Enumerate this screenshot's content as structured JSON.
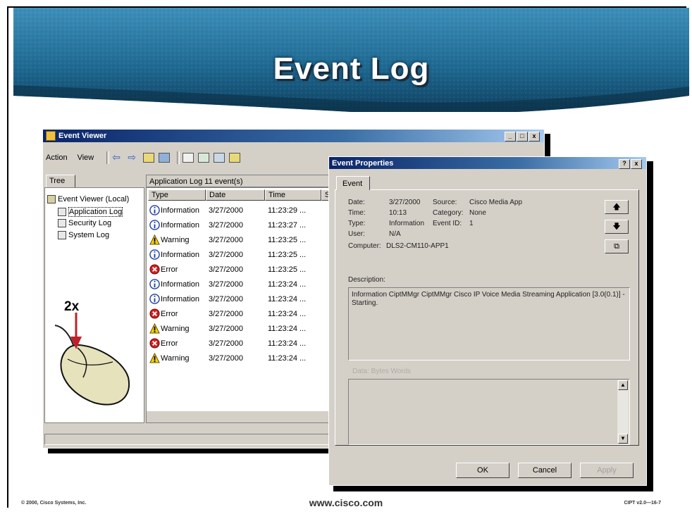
{
  "slide": {
    "title": "Event Log",
    "callout": "2x",
    "footer_left": "© 2000, Cisco Systems, Inc.",
    "footer_center": "www.cisco.com",
    "footer_right": "CIPT v2.0—16-7"
  },
  "event_viewer": {
    "title": "Event Viewer",
    "menu": [
      "Action",
      "View"
    ],
    "window_buttons": [
      "_",
      "□",
      "x"
    ],
    "tree_tab": "Tree",
    "tree": {
      "root": "Event Viewer (Local)",
      "items": [
        "Application Log",
        "Security Log",
        "System Log"
      ],
      "selected": "Application Log"
    },
    "list_header": "Application Log   11 event(s)",
    "columns": [
      "Type",
      "Date",
      "Time",
      "S"
    ],
    "rows": [
      {
        "type": "Information",
        "date": "3/27/2000",
        "time": "11:23:29 ...",
        "icon": "info-icon"
      },
      {
        "type": "Information",
        "date": "3/27/2000",
        "time": "11:23:27 ...",
        "icon": "info-icon"
      },
      {
        "type": "Warning",
        "date": "3/27/2000",
        "time": "11:23:25 ...",
        "icon": "warning-icon"
      },
      {
        "type": "Information",
        "date": "3/27/2000",
        "time": "11:23:25 ...",
        "icon": "info-icon"
      },
      {
        "type": "Error",
        "date": "3/27/2000",
        "time": "11:23:25 ...",
        "icon": "error-icon"
      },
      {
        "type": "Information",
        "date": "3/27/2000",
        "time": "11:23:24 ...",
        "icon": "info-icon"
      },
      {
        "type": "Information",
        "date": "3/27/2000",
        "time": "11:23:24 ...",
        "icon": "info-icon"
      },
      {
        "type": "Error",
        "date": "3/27/2000",
        "time": "11:23:24 ...",
        "icon": "error-icon"
      },
      {
        "type": "Warning",
        "date": "3/27/2000",
        "time": "11:23:24 ...",
        "icon": "warning-icon"
      },
      {
        "type": "Error",
        "date": "3/27/2000",
        "time": "11:23:24 ...",
        "icon": "error-icon"
      },
      {
        "type": "Warning",
        "date": "3/27/2000",
        "time": "11:23:24 ...",
        "icon": "warning-icon"
      }
    ]
  },
  "properties": {
    "title": "Event Properties",
    "window_buttons": [
      "?",
      "x"
    ],
    "tab": "Event",
    "fields": {
      "date_label": "Date:",
      "date": "3/27/2000",
      "source_label": "Source:",
      "source": "Cisco Media App",
      "time_label": "Time:",
      "time": "10:13",
      "category_label": "Category:",
      "category": "None",
      "type_label": "Type:",
      "type": "Information",
      "eventid_label": "Event ID:",
      "eventid": "1",
      "user_label": "User:",
      "user": "N/A",
      "computer_label": "Computer:",
      "computer": "DLS2-CM110-APP1"
    },
    "description_label": "Description:",
    "description": "Information    CiptMMgr CiptMMgr Cisco IP Voice Media Streaming Application [3.0(0.1)] - Starting.",
    "data_label": "Data:   Bytes   Words",
    "buttons": {
      "ok": "OK",
      "cancel": "Cancel",
      "apply": "Apply"
    },
    "nav_icons": [
      "up-arrow-icon",
      "down-arrow-icon",
      "copy-icon"
    ]
  },
  "colors": {
    "title_bar_start": "#0a246a",
    "title_bar_end": "#a6caf0",
    "window_face": "#d4d0c8",
    "banner": "#1d5f88",
    "mouse_body": "#e6e2bc",
    "arrow": "#c0202a"
  }
}
